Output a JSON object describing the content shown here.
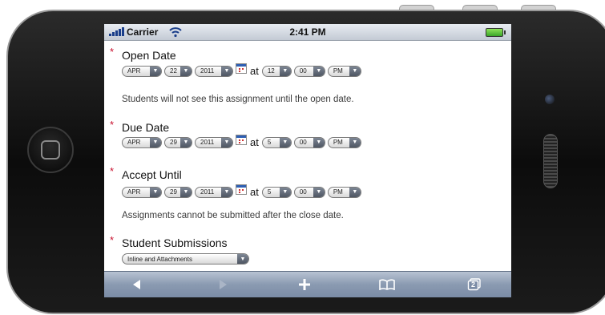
{
  "status_bar": {
    "carrier": "Carrier",
    "time": "2:41 PM"
  },
  "fields": {
    "open_date": {
      "label": "Open Date",
      "month": "APR",
      "day": "22",
      "year": "2011",
      "at": "at",
      "hour": "12",
      "minute": "00",
      "ampm": "PM",
      "note": "Students will not see this assignment until the open date."
    },
    "due_date": {
      "label": "Due Date",
      "month": "APR",
      "day": "29",
      "year": "2011",
      "at": "at",
      "hour": "5",
      "minute": "00",
      "ampm": "PM"
    },
    "accept_until": {
      "label": "Accept Until",
      "month": "APR",
      "day": "29",
      "year": "2011",
      "at": "at",
      "hour": "5",
      "minute": "00",
      "ampm": "PM",
      "note": "Assignments cannot be submitted after the close date."
    },
    "student_submissions": {
      "label": "Student Submissions",
      "value": "Inline and Attachments"
    }
  },
  "required_marker": "*",
  "toolbar": {
    "back_icon": "back-arrow-icon",
    "forward_icon": "forward-arrow-icon",
    "add_icon": "plus-icon",
    "bookmarks_icon": "book-icon",
    "pages_icon": "pages-icon",
    "pages_count": "2"
  }
}
